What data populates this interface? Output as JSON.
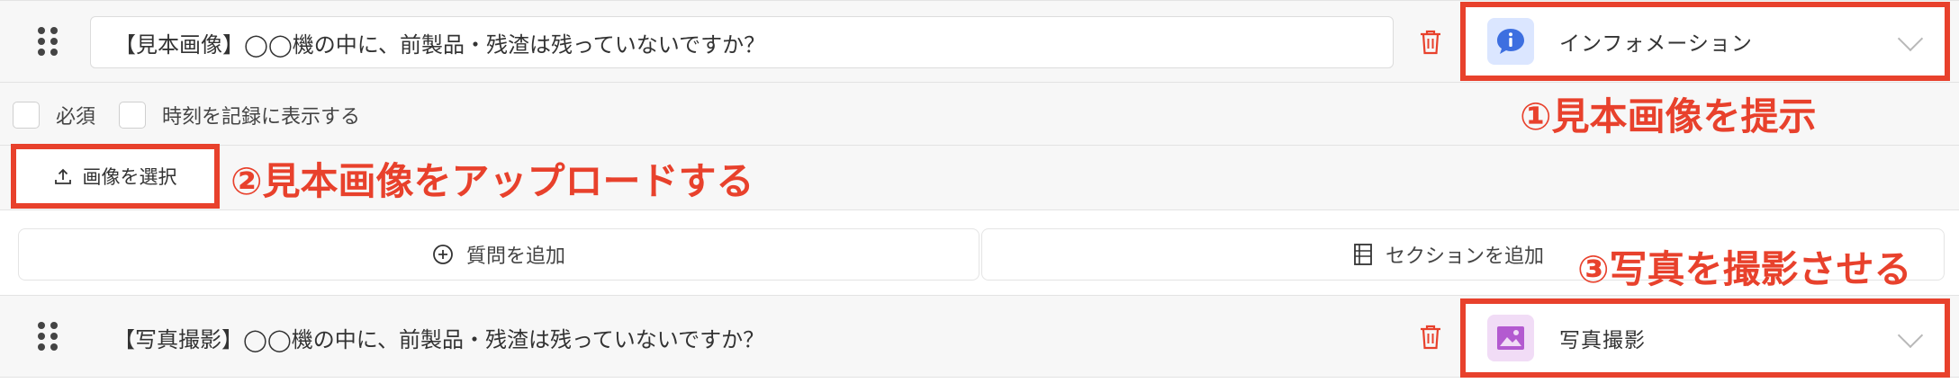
{
  "question1": {
    "text": "【見本画像】◯◯機の中に、前製品・残渣は残っていないですか？",
    "type_label": "インフォメーション",
    "type_icon": "info-chat-icon",
    "options": {
      "required_label": "必須",
      "timestamp_label": "時刻を記録に表示する"
    },
    "image_button_label": "画像を選択"
  },
  "add_bar": {
    "add_question_label": "質問を追加",
    "add_section_label": "セクションを追加"
  },
  "question2": {
    "text": "【写真撮影】◯◯機の中に、前製品・残渣は残っていないですか？",
    "type_label": "写真撮影",
    "type_icon": "image-icon"
  },
  "annotations": {
    "a1": "①見本画像を提示",
    "a2": "②見本画像をアップロードする",
    "a3": "③写真を撮影させる"
  },
  "colors": {
    "accent": "#e8412c",
    "info_icon_bg": "#dbe6ff",
    "info_icon": "#3d6fe0",
    "photo_icon_bg": "#f1dcf6",
    "photo_icon": "#b35ad0",
    "trash": "#e8412c"
  }
}
